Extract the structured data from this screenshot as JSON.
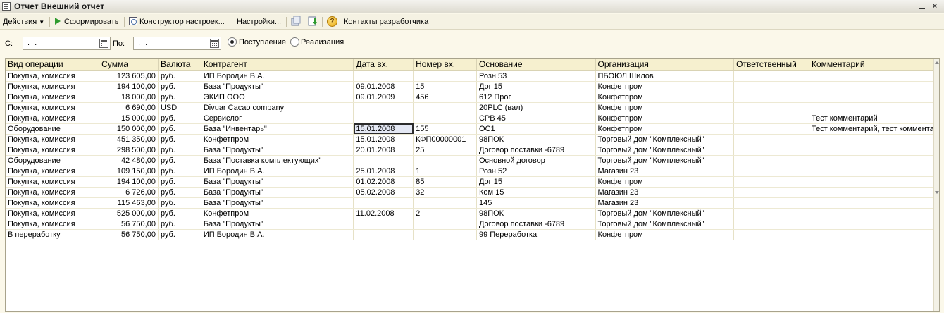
{
  "window": {
    "title": "Отчет  Внешний отчет",
    "minimize": "_",
    "close": "×"
  },
  "toolbar": {
    "actions": "Действия",
    "generate": "Сформировать",
    "settings_constructor": "Конструктор настроек...",
    "settings": "Настройки...",
    "developer_contacts": "Контакты разработчика",
    "help": "?"
  },
  "filters": {
    "from_label": "С:",
    "from_value": ". .",
    "to_label": "По:",
    "to_value": ". .",
    "radio_income": "Поступление",
    "radio_sale": "Реализация",
    "selected": "income"
  },
  "table": {
    "columns": [
      "Вид операции",
      "Сумма",
      "Валюта",
      "Контрагент",
      "Дата вх.",
      "Номер вх.",
      "Основание",
      "Организация",
      "Ответственный",
      "Комментарий"
    ],
    "rows": [
      [
        "Покупка, комиссия",
        "123 605,00",
        "руб.",
        "ИП Бородин В.А.",
        "",
        "",
        "Розн 53",
        "ПБОЮЛ  Шилов",
        "",
        ""
      ],
      [
        "Покупка, комиссия",
        "194 100,00",
        "руб.",
        "База \"Продукты\"",
        "09.01.2008",
        "15",
        "Дог 15",
        "Конфетпром",
        "",
        ""
      ],
      [
        "Покупка, комиссия",
        "18 000,00",
        "руб.",
        "ЭКИП ООО",
        "09.01.2009",
        "456",
        "612 Прог",
        "Конфетпром",
        "",
        ""
      ],
      [
        "Покупка, комиссия",
        "6 690,00",
        "USD",
        "Divuar Cacao company",
        "",
        "",
        "20PLC (вал)",
        "Конфетпром",
        "",
        ""
      ],
      [
        "Покупка, комиссия",
        "15 000,00",
        "руб.",
        "Сервислог",
        "",
        "",
        "СРВ 45",
        "Конфетпром",
        "",
        "Тест комментарий"
      ],
      [
        "Оборудование",
        "150 000,00",
        "руб.",
        "База \"Инвентарь\"",
        "15.01.2008",
        "155",
        "ОС1",
        "Конфетпром",
        "",
        "Тест комментарий, тест коммента"
      ],
      [
        "Покупка, комиссия",
        "451 350,00",
        "руб.",
        "Конфетпром",
        "15.01.2008",
        "КФП00000001",
        "98ПОК",
        "Торговый дом \"Комплексный\"",
        "",
        ""
      ],
      [
        "Покупка, комиссия",
        "298 500,00",
        "руб.",
        "База \"Продукты\"",
        "20.01.2008",
        "25",
        "Договор поставки -6789",
        "Торговый дом \"Комплексный\"",
        "",
        ""
      ],
      [
        "Оборудование",
        "42 480,00",
        "руб.",
        "База \"Поставка комплектующих\"",
        "",
        "",
        "Основной договор",
        "Торговый дом \"Комплексный\"",
        "",
        ""
      ],
      [
        "Покупка, комиссия",
        "109 150,00",
        "руб.",
        "ИП Бородин В.А.",
        "25.01.2008",
        "1",
        "Розн 52",
        "Магазин 23",
        "",
        ""
      ],
      [
        "Покупка, комиссия",
        "194 100,00",
        "руб.",
        "База \"Продукты\"",
        "01.02.2008",
        "85",
        "Дог 15",
        "Конфетпром",
        "",
        ""
      ],
      [
        "Покупка, комиссия",
        "6 726,00",
        "руб.",
        "База \"Продукты\"",
        "05.02.2008",
        "32",
        "Ком 15",
        "Магазин 23",
        "",
        ""
      ],
      [
        "Покупка, комиссия",
        "115 463,00",
        "руб.",
        "База \"Продукты\"",
        "",
        "",
        "145",
        "Магазин 23",
        "",
        ""
      ],
      [
        "Покупка, комиссия",
        "525 000,00",
        "руб.",
        "Конфетпром",
        "11.02.2008",
        "2",
        "98ПОК",
        "Торговый дом \"Комплексный\"",
        "",
        ""
      ],
      [
        "Покупка, комиссия",
        "56 750,00",
        "руб.",
        "База \"Продукты\"",
        "",
        "",
        "Договор поставки -6789",
        "Торговый дом \"Комплексный\"",
        "",
        ""
      ],
      [
        "В переработку",
        "56 750,00",
        "руб.",
        "ИП Бородин В.А.",
        "",
        "",
        "99 Переработка",
        "Конфетпром",
        "",
        ""
      ]
    ],
    "selected_cell": [
      5,
      4
    ]
  }
}
